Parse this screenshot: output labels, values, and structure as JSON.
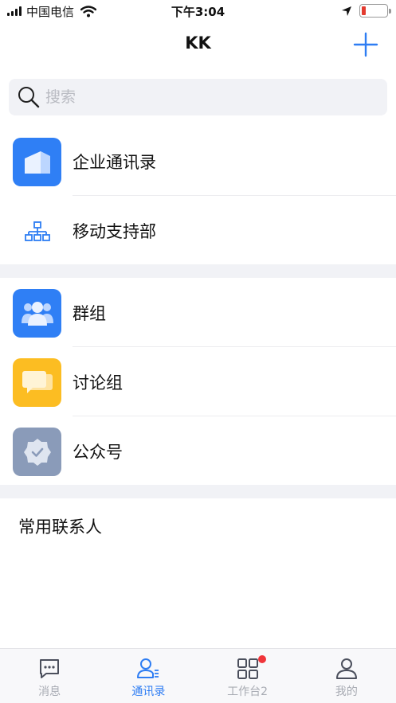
{
  "status_bar": {
    "carrier": "中国电信",
    "time": "下午3:04",
    "battery_color": "#e33b2f",
    "battery_level": 0.15
  },
  "nav": {
    "title": "KK",
    "add_icon": "plus-icon"
  },
  "search": {
    "placeholder": "搜索",
    "icon": "search-icon"
  },
  "directory": [
    {
      "label": "企业通讯录",
      "icon": "building-icon",
      "tile_color": "#2f7ff5"
    },
    {
      "label": "移动支持部",
      "icon": "org-chart-icon"
    }
  ],
  "groups": [
    {
      "label": "群组",
      "icon": "group-people-icon",
      "tile_color": "#2f7ff5"
    },
    {
      "label": "讨论组",
      "icon": "chat-bubbles-icon",
      "tile_color": "#fcbd22"
    },
    {
      "label": "公众号",
      "icon": "verified-badge-icon",
      "tile_color": "#8a9bb9"
    }
  ],
  "contacts_section": {
    "title": "常用联系人"
  },
  "tabs": [
    {
      "label": "消息",
      "icon": "message-icon",
      "active": false
    },
    {
      "label": "通讯录",
      "icon": "contacts-icon",
      "active": true
    },
    {
      "label": "工作台2",
      "icon": "workbench-icon",
      "active": false,
      "badge": true
    },
    {
      "label": "我的",
      "icon": "profile-icon",
      "active": false
    }
  ],
  "colors": {
    "accent": "#2e7df3",
    "inactive_tab": "#a8abb3",
    "badge": "#f0353a",
    "section_background": "#f1f2f6"
  }
}
